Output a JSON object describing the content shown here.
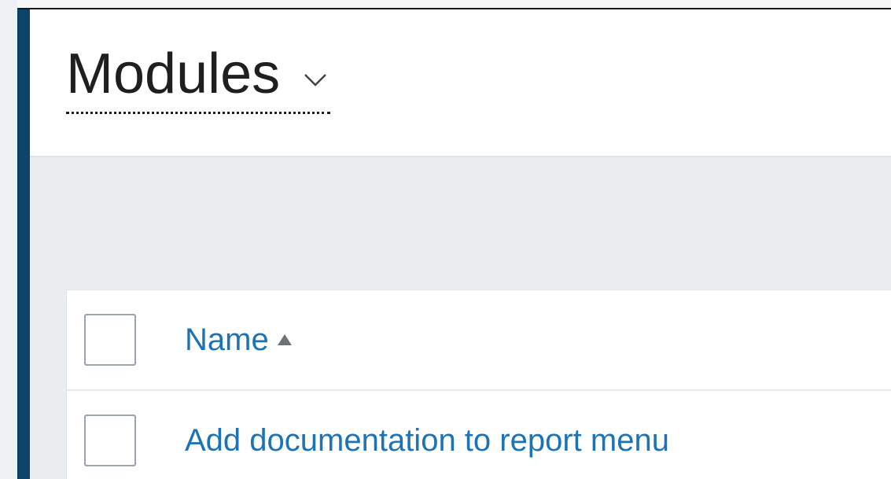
{
  "header": {
    "title": "Modules",
    "title_menu_icon": "chevron-down-icon"
  },
  "table": {
    "columns": [
      {
        "label": "Name",
        "sort": "ascending",
        "sort_icon": "sort-ascending-icon"
      }
    ],
    "rows": [
      {
        "name": "Add documentation to report menu"
      }
    ]
  },
  "colors": {
    "sidebar": "#0e4469",
    "link": "#1d73b5",
    "content_background": "#e9edf0",
    "title_text": "#1f1f1f"
  }
}
